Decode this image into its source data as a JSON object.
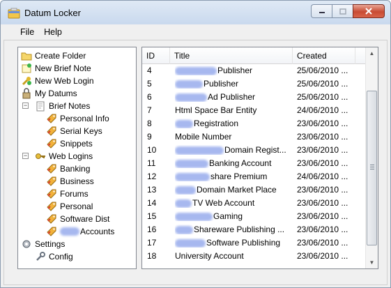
{
  "window": {
    "title": "Datum Locker"
  },
  "menu": {
    "items": [
      "File",
      "Help"
    ]
  },
  "tree": {
    "items": [
      {
        "label": "Create Folder",
        "icon": "folder-icon",
        "level": 0
      },
      {
        "label": "New Brief Note",
        "icon": "new-note-icon",
        "level": 0
      },
      {
        "label": "New Web Login",
        "icon": "new-login-icon",
        "level": 0
      },
      {
        "label": "My Datums",
        "icon": "lock-icon",
        "level": 0
      },
      {
        "label": "Brief Notes",
        "icon": "note-icon",
        "level": 1,
        "expander": "−"
      },
      {
        "label": "Personal Info",
        "icon": "tag-icon",
        "level": 2
      },
      {
        "label": "Serial Keys",
        "icon": "tag-icon",
        "level": 2
      },
      {
        "label": "Snippets",
        "icon": "tag-icon",
        "level": 2
      },
      {
        "label": "Web Logins",
        "icon": "key-icon",
        "level": 1,
        "expander": "−"
      },
      {
        "label": "Banking",
        "icon": "tag-icon",
        "level": 2
      },
      {
        "label": "Business",
        "icon": "tag-icon",
        "level": 2
      },
      {
        "label": "Forums",
        "icon": "tag-icon",
        "level": 2
      },
      {
        "label": "Personal",
        "icon": "tag-icon",
        "level": 2
      },
      {
        "label": "Software Dist",
        "icon": "tag-icon",
        "level": 2
      },
      {
        "label": "Accounts",
        "icon": "tag-icon",
        "level": 2,
        "redacted": true
      },
      {
        "label": "Settings",
        "icon": "settings-icon",
        "level": 0
      },
      {
        "label": "Config",
        "icon": "config-icon",
        "level": 1
      }
    ]
  },
  "list": {
    "columns": [
      "ID",
      "Title",
      "Created"
    ],
    "rows": [
      {
        "id": "4",
        "title": "Publisher",
        "created": "25/06/2010 ...",
        "redacted": true
      },
      {
        "id": "5",
        "title": "Publisher",
        "created": "25/06/2010 ...",
        "redacted": true
      },
      {
        "id": "6",
        "title": "Ad Publisher",
        "created": "25/06/2010 ...",
        "redacted": true
      },
      {
        "id": "7",
        "title": "Html Space Bar Entity",
        "created": "24/06/2010 ...",
        "redacted": false
      },
      {
        "id": "8",
        "title": "Registration",
        "created": "23/06/2010 ...",
        "redacted": true
      },
      {
        "id": "9",
        "title": "Mobile Number",
        "created": "23/06/2010 ...",
        "redacted": false
      },
      {
        "id": "10",
        "title": "Domain Regist...",
        "created": "23/06/2010 ...",
        "redacted": true
      },
      {
        "id": "11",
        "title": "Banking Account",
        "created": "23/06/2010 ...",
        "redacted": true
      },
      {
        "id": "12",
        "title": "share Premium",
        "created": "24/06/2010 ...",
        "redacted": true
      },
      {
        "id": "13",
        "title": "Domain Market Place",
        "created": "23/06/2010 ...",
        "redacted": true
      },
      {
        "id": "14",
        "title": "TV Web Account",
        "created": "23/06/2010 ...",
        "redacted": true
      },
      {
        "id": "15",
        "title": "Gaming",
        "created": "23/06/2010 ...",
        "redacted": true
      },
      {
        "id": "16",
        "title": "Shareware Publishing ...",
        "created": "23/06/2010 ...",
        "redacted": true
      },
      {
        "id": "17",
        "title": "Software Publishing",
        "created": "23/06/2010 ...",
        "redacted": true
      },
      {
        "id": "18",
        "title": "University Account",
        "created": "23/06/2010 ...",
        "redacted": false
      }
    ]
  },
  "colors": {
    "redaction": "#a7b8ef",
    "close_button": "#c84b33",
    "title_gradient": "#c9d9ee"
  }
}
